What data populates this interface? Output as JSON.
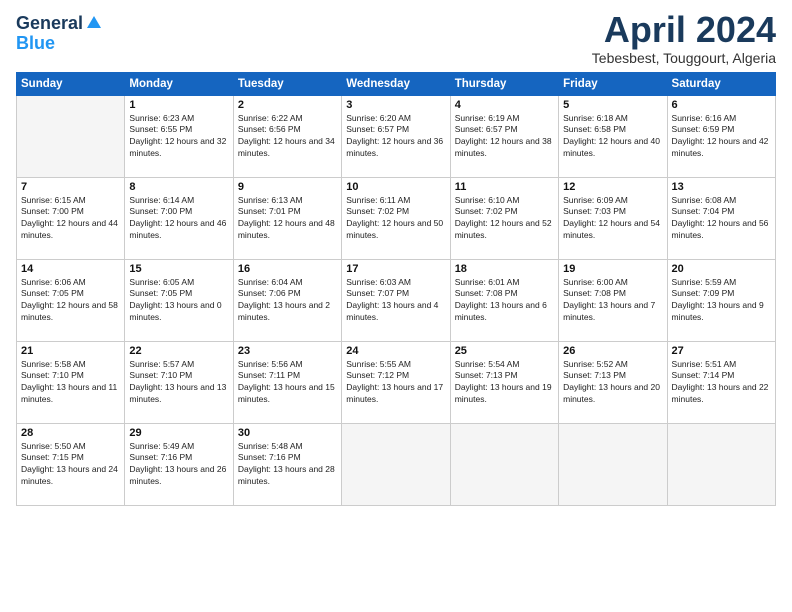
{
  "logo": {
    "general": "General",
    "blue": "Blue"
  },
  "title": "April 2024",
  "location": "Tebesbest, Touggourt, Algeria",
  "weekdays": [
    "Sunday",
    "Monday",
    "Tuesday",
    "Wednesday",
    "Thursday",
    "Friday",
    "Saturday"
  ],
  "weeks": [
    [
      {
        "day": "",
        "sunrise": "",
        "sunset": "",
        "daylight": ""
      },
      {
        "day": "1",
        "sunrise": "Sunrise: 6:23 AM",
        "sunset": "Sunset: 6:55 PM",
        "daylight": "Daylight: 12 hours and 32 minutes."
      },
      {
        "day": "2",
        "sunrise": "Sunrise: 6:22 AM",
        "sunset": "Sunset: 6:56 PM",
        "daylight": "Daylight: 12 hours and 34 minutes."
      },
      {
        "day": "3",
        "sunrise": "Sunrise: 6:20 AM",
        "sunset": "Sunset: 6:57 PM",
        "daylight": "Daylight: 12 hours and 36 minutes."
      },
      {
        "day": "4",
        "sunrise": "Sunrise: 6:19 AM",
        "sunset": "Sunset: 6:57 PM",
        "daylight": "Daylight: 12 hours and 38 minutes."
      },
      {
        "day": "5",
        "sunrise": "Sunrise: 6:18 AM",
        "sunset": "Sunset: 6:58 PM",
        "daylight": "Daylight: 12 hours and 40 minutes."
      },
      {
        "day": "6",
        "sunrise": "Sunrise: 6:16 AM",
        "sunset": "Sunset: 6:59 PM",
        "daylight": "Daylight: 12 hours and 42 minutes."
      }
    ],
    [
      {
        "day": "7",
        "sunrise": "Sunrise: 6:15 AM",
        "sunset": "Sunset: 7:00 PM",
        "daylight": "Daylight: 12 hours and 44 minutes."
      },
      {
        "day": "8",
        "sunrise": "Sunrise: 6:14 AM",
        "sunset": "Sunset: 7:00 PM",
        "daylight": "Daylight: 12 hours and 46 minutes."
      },
      {
        "day": "9",
        "sunrise": "Sunrise: 6:13 AM",
        "sunset": "Sunset: 7:01 PM",
        "daylight": "Daylight: 12 hours and 48 minutes."
      },
      {
        "day": "10",
        "sunrise": "Sunrise: 6:11 AM",
        "sunset": "Sunset: 7:02 PM",
        "daylight": "Daylight: 12 hours and 50 minutes."
      },
      {
        "day": "11",
        "sunrise": "Sunrise: 6:10 AM",
        "sunset": "Sunset: 7:02 PM",
        "daylight": "Daylight: 12 hours and 52 minutes."
      },
      {
        "day": "12",
        "sunrise": "Sunrise: 6:09 AM",
        "sunset": "Sunset: 7:03 PM",
        "daylight": "Daylight: 12 hours and 54 minutes."
      },
      {
        "day": "13",
        "sunrise": "Sunrise: 6:08 AM",
        "sunset": "Sunset: 7:04 PM",
        "daylight": "Daylight: 12 hours and 56 minutes."
      }
    ],
    [
      {
        "day": "14",
        "sunrise": "Sunrise: 6:06 AM",
        "sunset": "Sunset: 7:05 PM",
        "daylight": "Daylight: 12 hours and 58 minutes."
      },
      {
        "day": "15",
        "sunrise": "Sunrise: 6:05 AM",
        "sunset": "Sunset: 7:05 PM",
        "daylight": "Daylight: 13 hours and 0 minutes."
      },
      {
        "day": "16",
        "sunrise": "Sunrise: 6:04 AM",
        "sunset": "Sunset: 7:06 PM",
        "daylight": "Daylight: 13 hours and 2 minutes."
      },
      {
        "day": "17",
        "sunrise": "Sunrise: 6:03 AM",
        "sunset": "Sunset: 7:07 PM",
        "daylight": "Daylight: 13 hours and 4 minutes."
      },
      {
        "day": "18",
        "sunrise": "Sunrise: 6:01 AM",
        "sunset": "Sunset: 7:08 PM",
        "daylight": "Daylight: 13 hours and 6 minutes."
      },
      {
        "day": "19",
        "sunrise": "Sunrise: 6:00 AM",
        "sunset": "Sunset: 7:08 PM",
        "daylight": "Daylight: 13 hours and 7 minutes."
      },
      {
        "day": "20",
        "sunrise": "Sunrise: 5:59 AM",
        "sunset": "Sunset: 7:09 PM",
        "daylight": "Daylight: 13 hours and 9 minutes."
      }
    ],
    [
      {
        "day": "21",
        "sunrise": "Sunrise: 5:58 AM",
        "sunset": "Sunset: 7:10 PM",
        "daylight": "Daylight: 13 hours and 11 minutes."
      },
      {
        "day": "22",
        "sunrise": "Sunrise: 5:57 AM",
        "sunset": "Sunset: 7:10 PM",
        "daylight": "Daylight: 13 hours and 13 minutes."
      },
      {
        "day": "23",
        "sunrise": "Sunrise: 5:56 AM",
        "sunset": "Sunset: 7:11 PM",
        "daylight": "Daylight: 13 hours and 15 minutes."
      },
      {
        "day": "24",
        "sunrise": "Sunrise: 5:55 AM",
        "sunset": "Sunset: 7:12 PM",
        "daylight": "Daylight: 13 hours and 17 minutes."
      },
      {
        "day": "25",
        "sunrise": "Sunrise: 5:54 AM",
        "sunset": "Sunset: 7:13 PM",
        "daylight": "Daylight: 13 hours and 19 minutes."
      },
      {
        "day": "26",
        "sunrise": "Sunrise: 5:52 AM",
        "sunset": "Sunset: 7:13 PM",
        "daylight": "Daylight: 13 hours and 20 minutes."
      },
      {
        "day": "27",
        "sunrise": "Sunrise: 5:51 AM",
        "sunset": "Sunset: 7:14 PM",
        "daylight": "Daylight: 13 hours and 22 minutes."
      }
    ],
    [
      {
        "day": "28",
        "sunrise": "Sunrise: 5:50 AM",
        "sunset": "Sunset: 7:15 PM",
        "daylight": "Daylight: 13 hours and 24 minutes."
      },
      {
        "day": "29",
        "sunrise": "Sunrise: 5:49 AM",
        "sunset": "Sunset: 7:16 PM",
        "daylight": "Daylight: 13 hours and 26 minutes."
      },
      {
        "day": "30",
        "sunrise": "Sunrise: 5:48 AM",
        "sunset": "Sunset: 7:16 PM",
        "daylight": "Daylight: 13 hours and 28 minutes."
      },
      {
        "day": "",
        "sunrise": "",
        "sunset": "",
        "daylight": ""
      },
      {
        "day": "",
        "sunrise": "",
        "sunset": "",
        "daylight": ""
      },
      {
        "day": "",
        "sunrise": "",
        "sunset": "",
        "daylight": ""
      },
      {
        "day": "",
        "sunrise": "",
        "sunset": "",
        "daylight": ""
      }
    ]
  ]
}
